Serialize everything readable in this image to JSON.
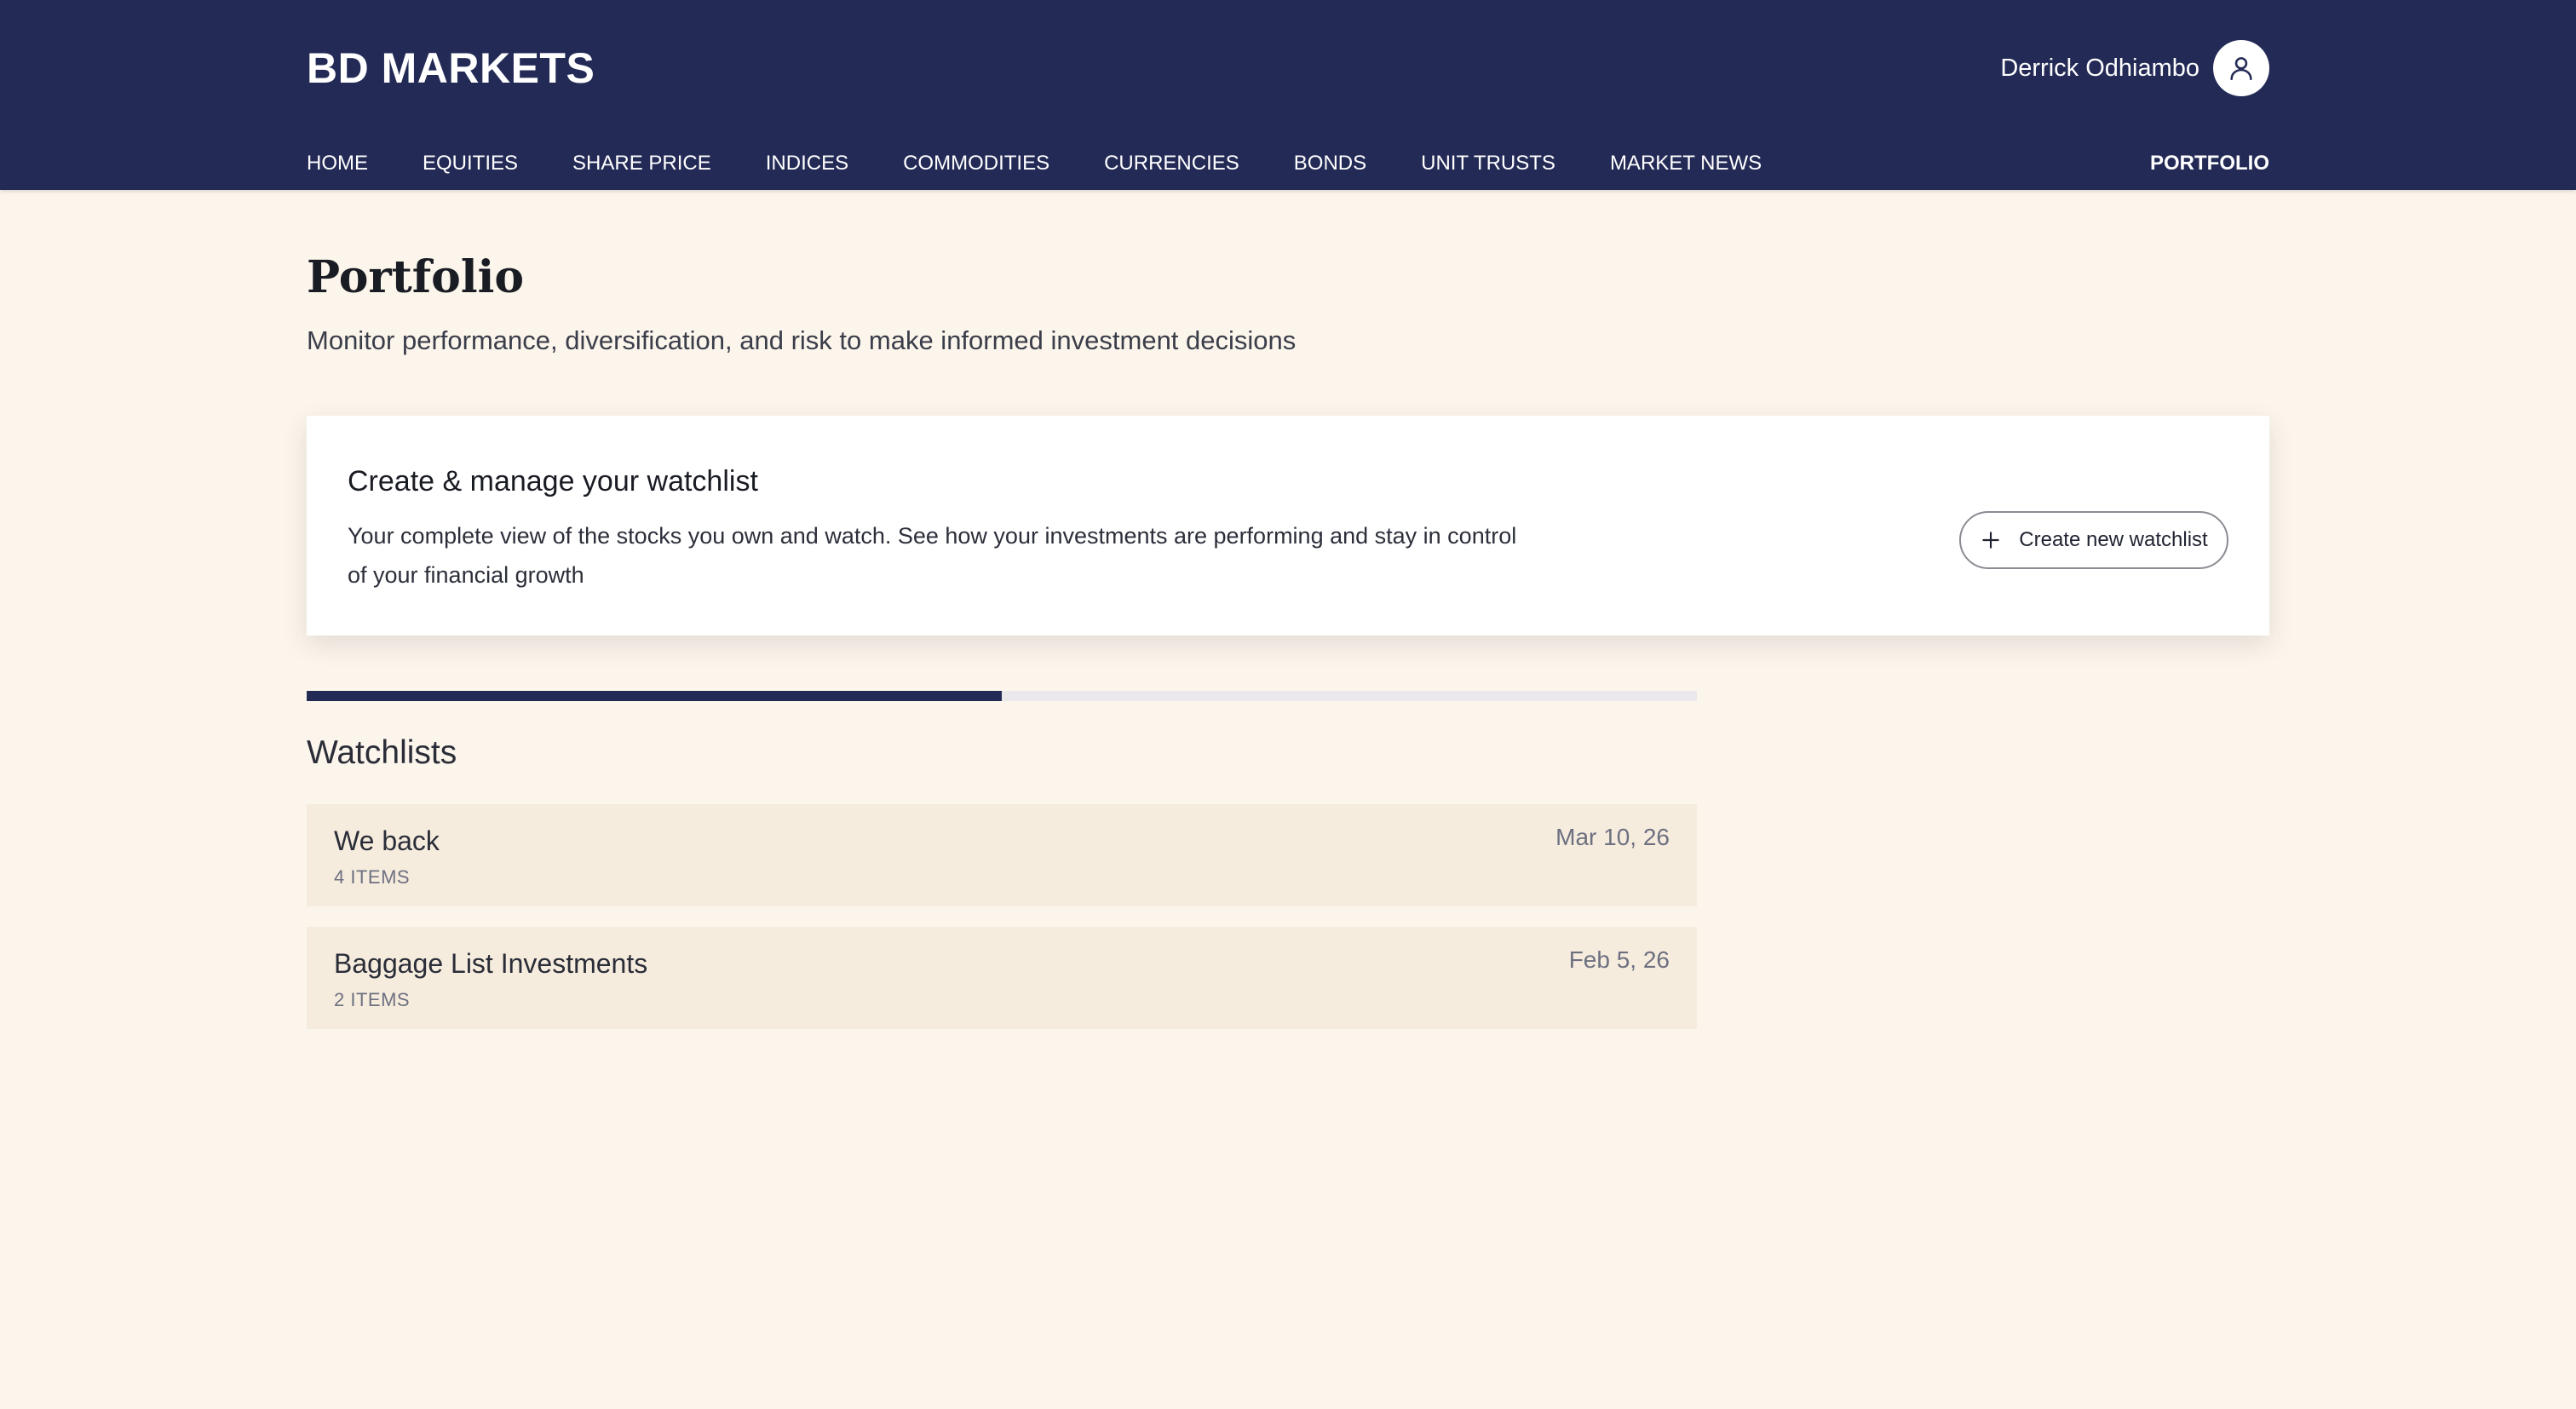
{
  "header": {
    "brand": "BD MARKETS",
    "user_name": "Derrick Odhiambo",
    "avatar_icon": "user-icon",
    "nav": [
      {
        "label": "HOME"
      },
      {
        "label": "EQUITIES"
      },
      {
        "label": "SHARE PRICE"
      },
      {
        "label": "INDICES"
      },
      {
        "label": "COMMODITIES"
      },
      {
        "label": "CURRENCIES"
      },
      {
        "label": "BONDS"
      },
      {
        "label": "UNIT TRUSTS"
      },
      {
        "label": "MARKET NEWS"
      }
    ],
    "portfolio_label": "PORTFOLIO"
  },
  "page": {
    "title": "Portfolio",
    "subtitle": "Monitor performance, diversification, and risk to make informed investment decisions"
  },
  "card": {
    "title": "Create & manage your watchlist",
    "description": "Your complete view of the stocks you own and watch. See how your investments are performing and stay in control of your financial growth",
    "button_label": "Create new watchlist",
    "button_icon": "plus-icon"
  },
  "progress": {
    "fraction": 0.5
  },
  "watchlists": {
    "title": "Watchlists",
    "items": [
      {
        "name": "We back",
        "count": "4 ITEMS",
        "date": "Mar 10, 26"
      },
      {
        "name": "Baggage List Investments",
        "count": "2 ITEMS",
        "date": "Feb 5, 26"
      }
    ]
  },
  "colors": {
    "header_bg": "#232a56",
    "page_bg": "#fcf5eb",
    "list_item_bg": "#f6ecde",
    "progress_fill": "#232a56",
    "progress_track": "#eae8ea"
  }
}
